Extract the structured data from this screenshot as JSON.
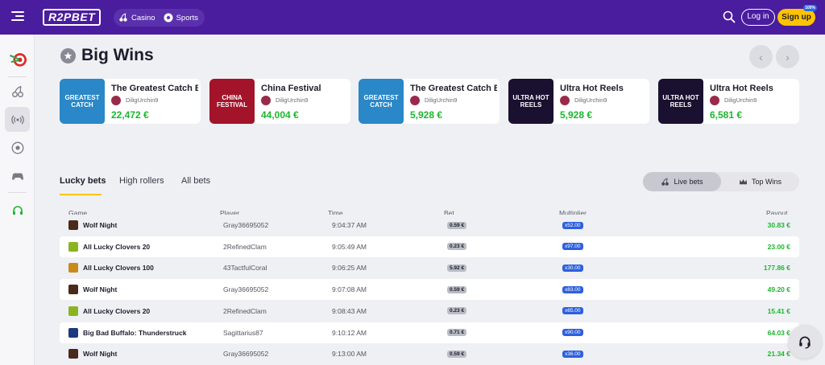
{
  "header": {
    "logo_text": "R2PBET",
    "nav": [
      {
        "label": "Casino",
        "icon": "cherries-icon"
      },
      {
        "label": "Sports",
        "icon": "soccer-ball-icon"
      }
    ],
    "login_label": "Log in",
    "signup_label": "Sign up",
    "signup_badge": "100%"
  },
  "sidebar": {
    "items": [
      {
        "icon": "target-darts-icon"
      },
      {
        "icon": "cherries-icon"
      },
      {
        "icon": "live-broadcast-icon",
        "active": true
      },
      {
        "icon": "soccer-ball-icon"
      },
      {
        "icon": "gamepad-icon"
      },
      {
        "icon": "headset-icon"
      }
    ]
  },
  "big_wins": {
    "title": "Big Wins",
    "cards": [
      {
        "game": "The Greatest Catch Bo",
        "user": "DiligUrchin9",
        "amount": "22,472 €",
        "thumb_text": "GREATEST CATCH",
        "thumb_color": "#2a87c8"
      },
      {
        "game": "China Festival",
        "user": "DiligUrchin9",
        "amount": "44,004 €",
        "thumb_text": "CHINA FESTIVAL",
        "thumb_color": "#a3142a"
      },
      {
        "game": "The Greatest Catch Bo",
        "user": "DiligUrchin9",
        "amount": "5,928 €",
        "thumb_text": "GREATEST CATCH",
        "thumb_color": "#2a87c8"
      },
      {
        "game": "Ultra Hot Reels",
        "user": "DiligUrchin9",
        "amount": "5,928 €",
        "thumb_text": "ULTRA HOT REELS",
        "thumb_color": "#1a1030"
      },
      {
        "game": "Ultra Hot Reels",
        "user": "DiligUrchin9",
        "amount": "6,581 €",
        "thumb_text": "ULTRA HOT REELS",
        "thumb_color": "#1a1030"
      }
    ]
  },
  "tabs": [
    {
      "label": "Lucky bets",
      "active": true
    },
    {
      "label": "High rollers"
    },
    {
      "label": "All bets"
    }
  ],
  "toggle": {
    "live_label": "Live bets",
    "top_label": "Top Wins"
  },
  "table": {
    "headers": {
      "game": "Game",
      "player": "Player",
      "time": "Time",
      "bet": "Bet",
      "multiplier": "Multiplier",
      "payout": "Payout"
    },
    "rows": [
      {
        "game": "Wolf Night",
        "player": "Gray36695052",
        "time": "9:04:37 AM",
        "bet": "0.59 €",
        "multiplier": "x52.00",
        "payout": "30.83 €",
        "icon_color": "#4a2a1a"
      },
      {
        "game": "All Lucky Clovers 20",
        "player": "2RefinedClam",
        "time": "9:05:49 AM",
        "bet": "0.23 €",
        "multiplier": "x97.00",
        "payout": "23.00 €",
        "icon_color": "#8ab520"
      },
      {
        "game": "All Lucky Clovers 100",
        "player": "43TactfulCoral",
        "time": "9:06:25 AM",
        "bet": "5.92 €",
        "multiplier": "x30.00",
        "payout": "177.86 €",
        "icon_color": "#c98a1a"
      },
      {
        "game": "Wolf Night",
        "player": "Gray36695052",
        "time": "9:07:08 AM",
        "bet": "0.59 €",
        "multiplier": "x83.00",
        "payout": "49.20 €",
        "icon_color": "#4a2a1a"
      },
      {
        "game": "All Lucky Clovers 20",
        "player": "2RefinedClam",
        "time": "9:08:43 AM",
        "bet": "0.23 €",
        "multiplier": "x65.00",
        "payout": "15.41 €",
        "icon_color": "#8ab520"
      },
      {
        "game": "Big Bad Buffalo: Thunderstruck",
        "player": "Sagittarius87",
        "time": "9:10:12 AM",
        "bet": "0.71 €",
        "multiplier": "x90.00",
        "payout": "64.03 €",
        "icon_color": "#1a3a7a"
      },
      {
        "game": "Wolf Night",
        "player": "Gray36695052",
        "time": "9:13:00 AM",
        "bet": "0.59 €",
        "multiplier": "x36.00",
        "payout": "21.34 €",
        "icon_color": "#4a2a1a"
      }
    ]
  },
  "colors": {
    "brand": "#4a1c9e",
    "accent": "#ffc400",
    "win_green": "#1bb82d",
    "multiplier_blue": "#2d5fde"
  }
}
